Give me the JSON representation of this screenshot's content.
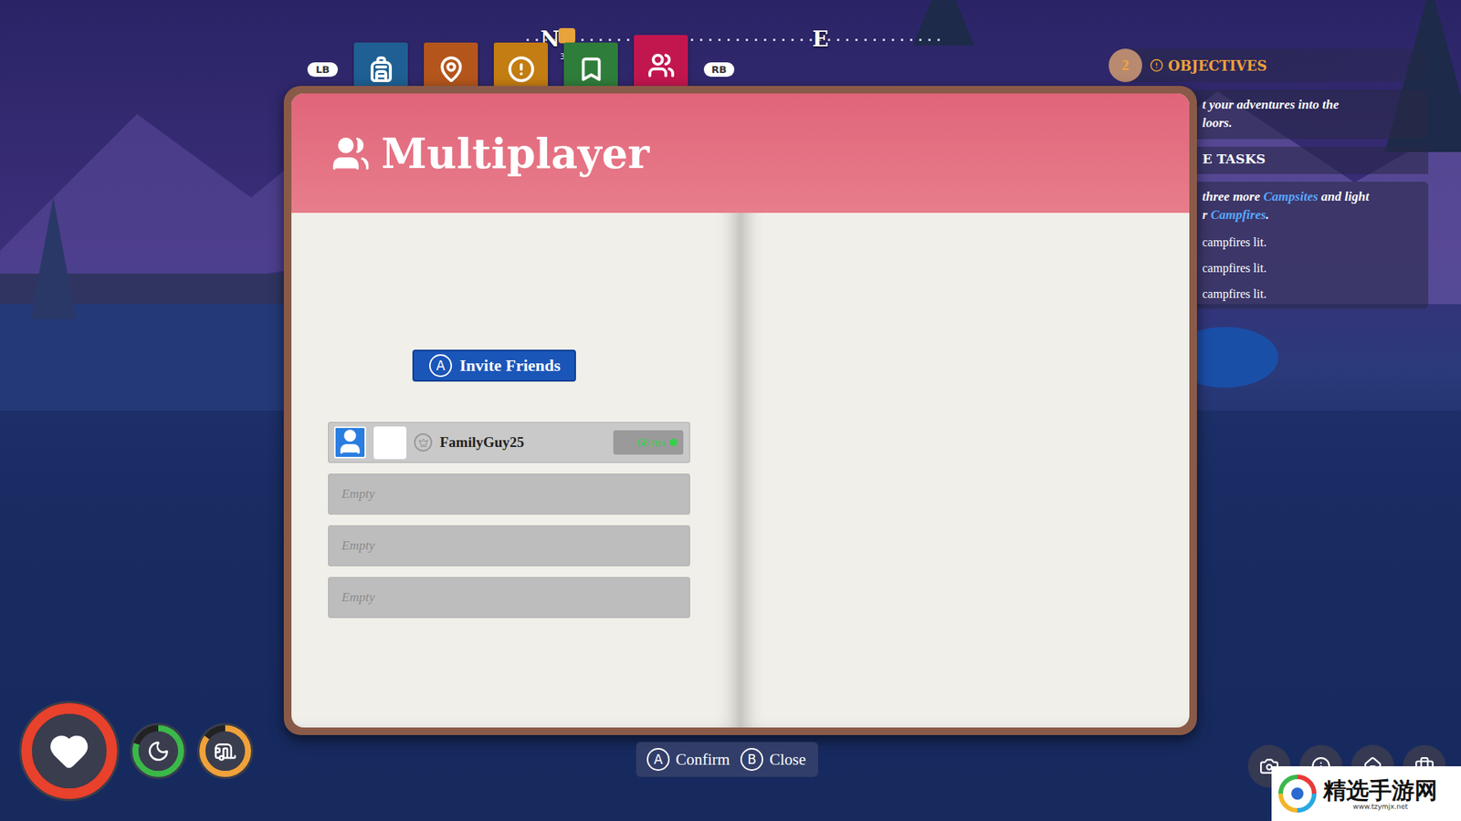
{
  "hud": {
    "left_bumper": "LB",
    "right_bumper": "RB"
  },
  "tabs": [
    {
      "kind": "backpack",
      "selected": false,
      "color": "#1f5f93"
    },
    {
      "kind": "map",
      "selected": false,
      "color": "#b4561c"
    },
    {
      "kind": "alerts",
      "selected": false,
      "color": "#c47d12"
    },
    {
      "kind": "bookmarks",
      "selected": false,
      "color": "#2f7d3a"
    },
    {
      "kind": "multiplayer",
      "selected": true,
      "color": "#c2164f"
    }
  ],
  "compass": {
    "marks": [
      "N",
      "E"
    ],
    "bearing": "34"
  },
  "book": {
    "title": "Multiplayer",
    "invite_button": {
      "key": "A",
      "label": "Invite Friends"
    },
    "players": [
      {
        "kind": "player",
        "name": "FamilyGuy25",
        "host": true,
        "ping": "68 ms"
      },
      {
        "kind": "empty",
        "name": "Empty"
      },
      {
        "kind": "empty",
        "name": "Empty"
      },
      {
        "kind": "empty",
        "name": "Empty"
      }
    ]
  },
  "hints": [
    {
      "key": "A",
      "label": "Confirm"
    },
    {
      "key": "B",
      "label": "Close"
    }
  ],
  "objectives": {
    "count": "2",
    "title": "OBJECTIVES",
    "description": [
      "t your adventures into the",
      "loors."
    ],
    "tasks_title": "E TASKS",
    "task_lines": [
      [
        {
          "text": "three more ",
          "highlight": false
        },
        {
          "text": "Campsites",
          "highlight": true
        },
        {
          "text": " and light",
          "highlight": false
        }
      ],
      [
        {
          "text": "r ",
          "highlight": false
        },
        {
          "text": "Campfires",
          "highlight": true
        },
        {
          "text": ".",
          "highlight": false
        }
      ]
    ],
    "progress": [
      "campfires lit.",
      "campfires lit.",
      "campfires lit."
    ]
  },
  "meters": [
    {
      "kind": "health",
      "level": 1,
      "color": "#e8412c"
    },
    {
      "kind": "rest",
      "level": 0.8,
      "color": "#3bb84a"
    },
    {
      "kind": "van",
      "level": 0.85,
      "color": "#f0a23a"
    }
  ],
  "watermark": {
    "name": "精选手游网",
    "url": "www.tzymjx.net"
  }
}
